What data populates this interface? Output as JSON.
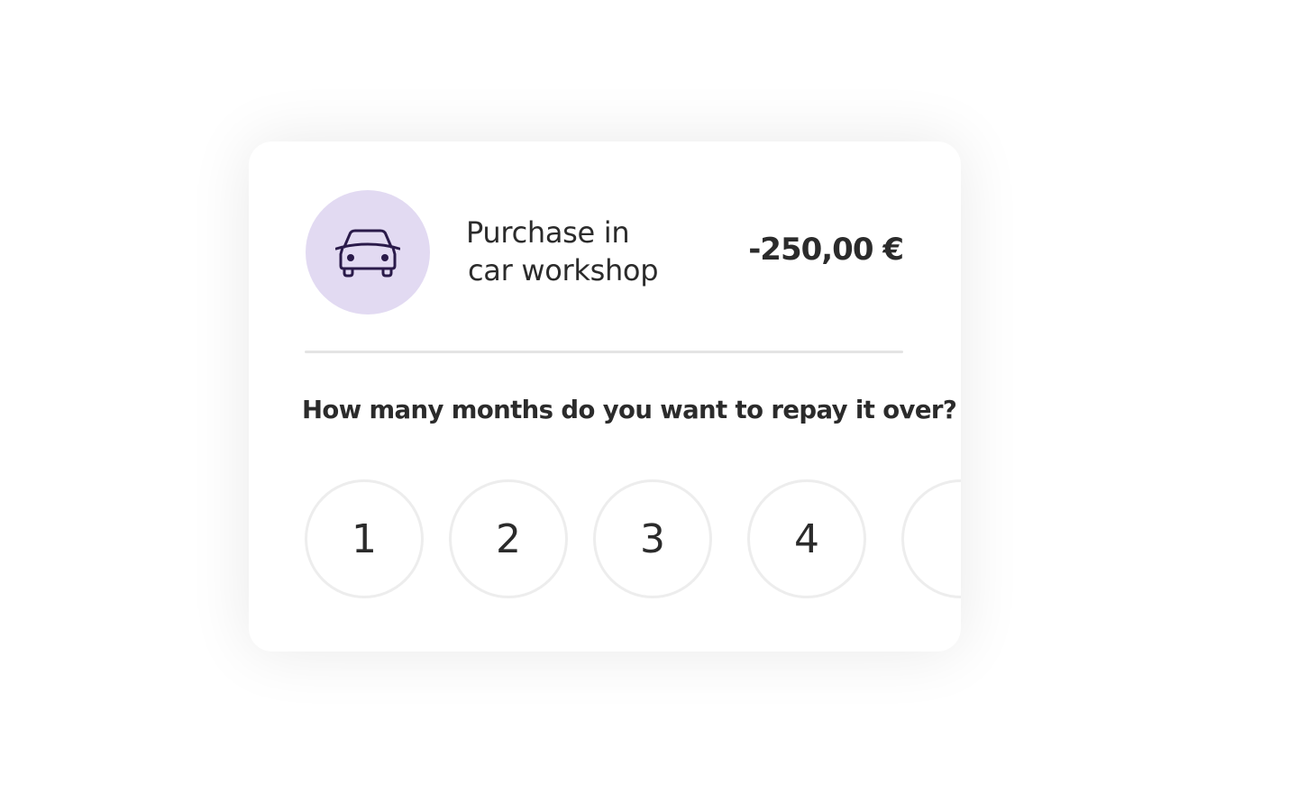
{
  "transaction": {
    "icon": "car-icon",
    "title_line1": "Purchase in",
    "title_line2": "car workshop",
    "amount": "-250,00 €"
  },
  "repayment": {
    "question": "How many months do you want to repay it over?",
    "options": [
      "1",
      "2",
      "3",
      "4",
      ""
    ]
  },
  "colors": {
    "icon_bg": "#e2daf2",
    "icon_stroke": "#2a1a4a",
    "text": "#2b2b2b",
    "divider": "#e4e4e4",
    "option_border": "#ededed"
  }
}
